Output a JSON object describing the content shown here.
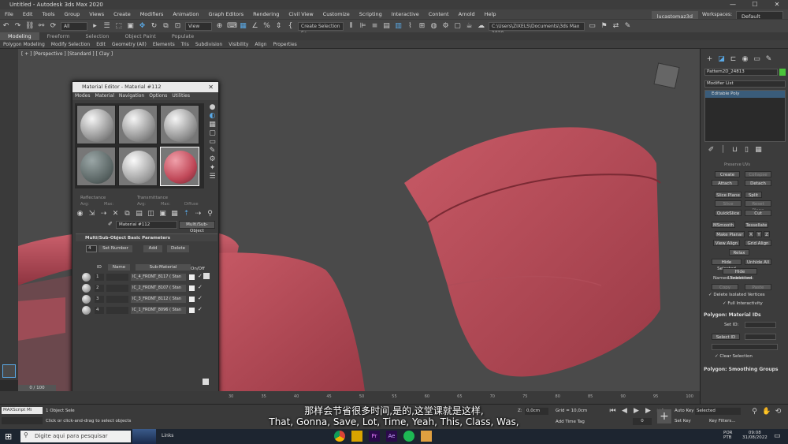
{
  "window": {
    "title": "Untitled - Autodesk 3ds Max 2020",
    "min": "—",
    "max": "☐",
    "close": "✕"
  },
  "menu": [
    "File",
    "Edit",
    "Tools",
    "Group",
    "Views",
    "Create",
    "Modifiers",
    "Animation",
    "Graph Editors",
    "Rendering",
    "Civil View",
    "Customize",
    "Scripting",
    "Interactive",
    "Content",
    "Arnold",
    "Help"
  ],
  "account": {
    "user": "lucastomaz3d",
    "workspaces_label": "Workspaces:",
    "workspace": "Default"
  },
  "toolbar": {
    "filter": "All",
    "refsys": "View",
    "selset": "Create Selection Se",
    "path": "C:\\Users\\ZIXELS\\Documents\\3ds Max 2020"
  },
  "ribbon_tabs": [
    "Modeling",
    "Freeform",
    "Selection",
    "Object Paint",
    "Populate"
  ],
  "ribbon_items": [
    "Polygon Modeling",
    "Modify Selection",
    "Edit",
    "Geometry (All)",
    "Elements",
    "Tris",
    "Subdivision",
    "Visibility",
    "Align",
    "Properties"
  ],
  "viewport": {
    "label": "[ + ] [Perspective ] [Standard ] [ Clay ]"
  },
  "material_editor": {
    "title": "Material Editor - Material #112",
    "menu": [
      "Modes",
      "Material",
      "Navigation",
      "Options",
      "Utilities"
    ],
    "labels": {
      "reflectance": "Reflectance",
      "transmittance": "Transmittance",
      "avg": "Avg:",
      "max": "Max:",
      "avg2": "Avg:",
      "max2": "Max:",
      "diffuse": "Diffuse"
    },
    "material_name": "Material #112",
    "material_type": "Multi/Sub-Object",
    "rollout": "Multi/Sub-Object Basic Parameters",
    "count": "4",
    "set_number": "Set Number",
    "add": "Add",
    "delete": "Delete",
    "col_id": "ID",
    "col_name": "Name",
    "col_sub": "Sub-Material",
    "col_onoff": "On/Off",
    "rows": [
      {
        "id": "1",
        "sub": "IC_4_FRONT_8117  ( Stan"
      },
      {
        "id": "2",
        "sub": "IC_2_FRONT_8107  ( Stan"
      },
      {
        "id": "3",
        "sub": "IC_3_FRONT_8112  ( Stan"
      },
      {
        "id": "4",
        "sub": "IC_1_FRONT_8096  ( Stan"
      }
    ]
  },
  "command_panel": {
    "object_name": "Pattern2D_24813",
    "modifier_list": "Modifier List",
    "stack_item": "Editable Poly",
    "preserve_uvs": "Preserve UVs",
    "buttons": {
      "create": "Create",
      "collapse": "Collapse",
      "attach": "Attach",
      "detach": "Detach",
      "slice_plane": "Slice Plane",
      "split": "Split",
      "slice": "Slice",
      "reset_plane": "Reset Plane",
      "quickslice": "QuickSlice",
      "cut": "Cut",
      "msmooth": "MSmooth",
      "tessellate": "Tessellate",
      "make_planar": "Make Planar",
      "x": "X",
      "y": "Y",
      "z": "Z",
      "view_align": "View Align",
      "grid_align": "Grid Align",
      "relax": "Relax",
      "hide_selected": "Hide Selected",
      "unhide_all": "Unhide All",
      "hide_unselected": "Hide Unselected",
      "copy": "Copy",
      "paste": "Paste"
    },
    "named_selections": "Named Selections:",
    "delete_isolated": "Delete Isolated Vertices",
    "full_interactivity": "Full Interactivity",
    "material_ids": "Polygon: Material IDs",
    "set_id": "Set ID:",
    "select_id": "Select ID",
    "clear_selection": "Clear Selection",
    "smoothing_groups": "Polygon: Smoothing Groups"
  },
  "timeline": {
    "frame": "0 / 100",
    "ticks": [
      "30",
      "35",
      "40",
      "45",
      "50",
      "55",
      "60",
      "65",
      "70",
      "75",
      "80",
      "85",
      "90",
      "95",
      "100"
    ]
  },
  "status": {
    "selected": "1 Object Sele",
    "hint": "Click or click-and-drag to select objects",
    "maxscript": "MAXScript Mi",
    "z_label": "Z:",
    "z_val": "0,0cm",
    "grid": "Grid = 10,0cm",
    "add_time_tag": "Add Time Tag",
    "auto_key": "Auto Key",
    "selected_dd": "Selected",
    "set_key": "Set Key",
    "key_filters": "Key Filters...",
    "frame_field": "0"
  },
  "subtitles": {
    "line1": "那样会节省很多时间,是的,这堂课就是这样,",
    "line2": "That, Gonna, Save, Lot, Time, Yeah, This, Class, Was,"
  },
  "taskbar": {
    "search": "Digite aqui para pesquisar",
    "links": "Links",
    "lang1": "POR",
    "lang2": "PTB",
    "time": "09:08",
    "date": "31/08/2022"
  }
}
